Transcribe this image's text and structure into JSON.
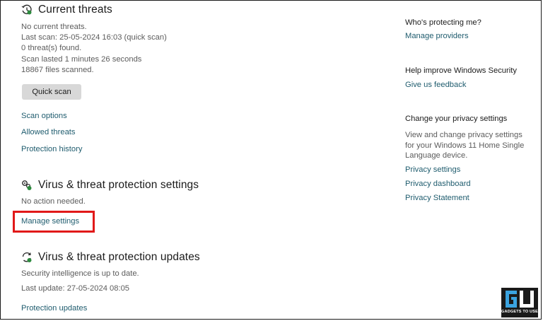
{
  "current_threats": {
    "title": "Current threats",
    "lines": [
      "No current threats.",
      "Last scan: 25-05-2024 16:03 (quick scan)",
      "0 threat(s) found.",
      "Scan lasted 1 minutes 26 seconds",
      "18867 files scanned."
    ],
    "quick_scan_label": "Quick scan",
    "links": [
      "Scan options",
      "Allowed threats",
      "Protection history"
    ]
  },
  "settings": {
    "title": "Virus & threat protection settings",
    "status": "No action needed.",
    "manage_link": "Manage settings"
  },
  "updates": {
    "title": "Virus & threat protection updates",
    "status": "Security intelligence is up to date.",
    "last_update": "Last update: 27-05-2024 08:05",
    "link": "Protection updates"
  },
  "sidebar": {
    "protecting_heading": "Who's protecting me?",
    "manage_providers": "Manage providers",
    "improve_heading": "Help improve Windows Security",
    "feedback": "Give us feedback",
    "privacy_heading": "Change your privacy settings",
    "privacy_text": [
      "View and change privacy settings",
      "for your Windows 11 Home Single",
      "Language device."
    ],
    "privacy_links": [
      "Privacy settings",
      "Privacy dashboard",
      "Privacy Statement"
    ]
  },
  "watermark": {
    "logo_text": "GU",
    "tagline": "GADGETS TO USE"
  },
  "colors": {
    "link": "#1f5c6e",
    "highlight": "#e11919",
    "button_bg": "#d8d8d8"
  },
  "icons": [
    "threat-history-icon",
    "settings-gears-icon",
    "update-refresh-icon"
  ]
}
